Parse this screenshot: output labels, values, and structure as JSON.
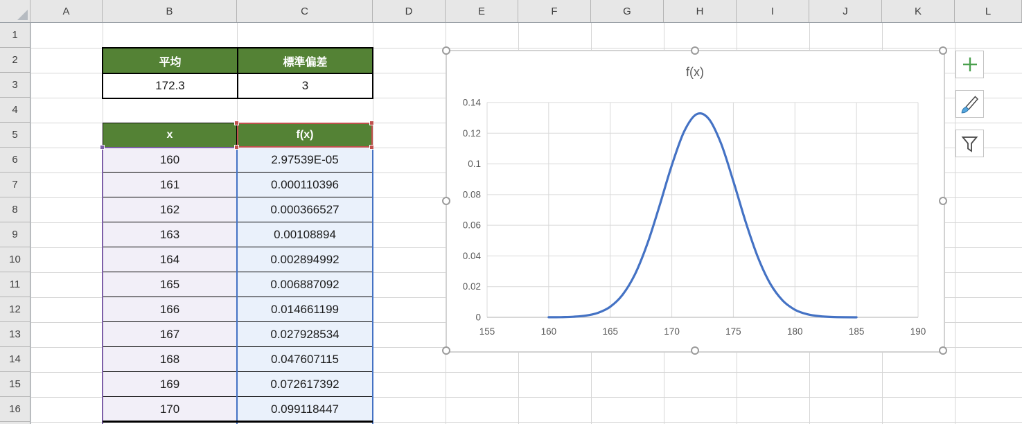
{
  "grid": {
    "columns": [
      "A",
      "B",
      "C",
      "D",
      "E",
      "F",
      "G",
      "H",
      "I",
      "J",
      "K",
      "L"
    ],
    "rows": [
      "1",
      "2",
      "3",
      "4",
      "5",
      "6",
      "7",
      "8",
      "9",
      "10",
      "11",
      "12",
      "13",
      "14",
      "15",
      "16"
    ]
  },
  "stats_table": {
    "headers": [
      "平均",
      "標準偏差"
    ],
    "values": [
      "172.3",
      "3"
    ]
  },
  "data_table": {
    "headers": [
      "x",
      "f(x)"
    ],
    "rows": [
      [
        "160",
        "2.97539E-05"
      ],
      [
        "161",
        "0.000110396"
      ],
      [
        "162",
        "0.000366527"
      ],
      [
        "163",
        "0.00108894"
      ],
      [
        "164",
        "0.002894992"
      ],
      [
        "165",
        "0.006887092"
      ],
      [
        "166",
        "0.014661199"
      ],
      [
        "167",
        "0.027928534"
      ],
      [
        "168",
        "0.047607115"
      ],
      [
        "169",
        "0.072617392"
      ],
      [
        "170",
        "0.099118447"
      ]
    ]
  },
  "chart": {
    "title": "f(x)",
    "y_ticks": [
      "0.14",
      "0.12",
      "0.1",
      "0.08",
      "0.06",
      "0.04",
      "0.02",
      "0"
    ],
    "x_ticks": [
      "155",
      "160",
      "165",
      "170",
      "175",
      "180",
      "185",
      "190"
    ]
  },
  "chart_buttons": [
    {
      "name": "chart-elements",
      "icon": "plus-icon"
    },
    {
      "name": "chart-styles",
      "icon": "brush-icon"
    },
    {
      "name": "chart-filters",
      "icon": "funnel-icon"
    }
  ],
  "chart_data": {
    "type": "line",
    "title": "f(x)",
    "x": [
      160,
      161,
      162,
      163,
      164,
      165,
      166,
      167,
      168,
      169,
      170,
      171,
      172,
      173,
      174,
      175,
      176,
      177,
      178,
      179,
      180,
      181,
      182,
      183,
      184,
      185
    ],
    "values": [
      2.97539e-05,
      0.000110396,
      0.000366527,
      0.00108894,
      0.002894992,
      0.006887092,
      0.014661199,
      0.027928534,
      0.047607115,
      0.072617392,
      0.099118447,
      0.121062,
      0.132316,
      0.129408,
      0.113259,
      0.088694,
      0.062157,
      0.038978,
      0.021872,
      0.010988,
      0.004938,
      0.001984,
      0.000714,
      0.00023,
      6.61e-05,
      1.71e-05
    ],
    "xlabel": "",
    "ylabel": "",
    "xlim": [
      155,
      190
    ],
    "ylim": [
      0,
      0.14
    ],
    "x_tick_step": 5,
    "y_tick_step": 0.02,
    "grid": true,
    "legend": "none",
    "series_color": "#4472C4",
    "mean": 172.3,
    "std_dev": 3
  },
  "colors": {
    "header_green": "#548235",
    "series_blue": "#4472C4",
    "category_purple": "#7D5FA8",
    "category_fill": "#F2EFF8",
    "values_fill": "#EAF1FB",
    "selection_red": "#C0504D",
    "chart_gray_text": "#595959",
    "gridline": "#D6D6D6"
  }
}
